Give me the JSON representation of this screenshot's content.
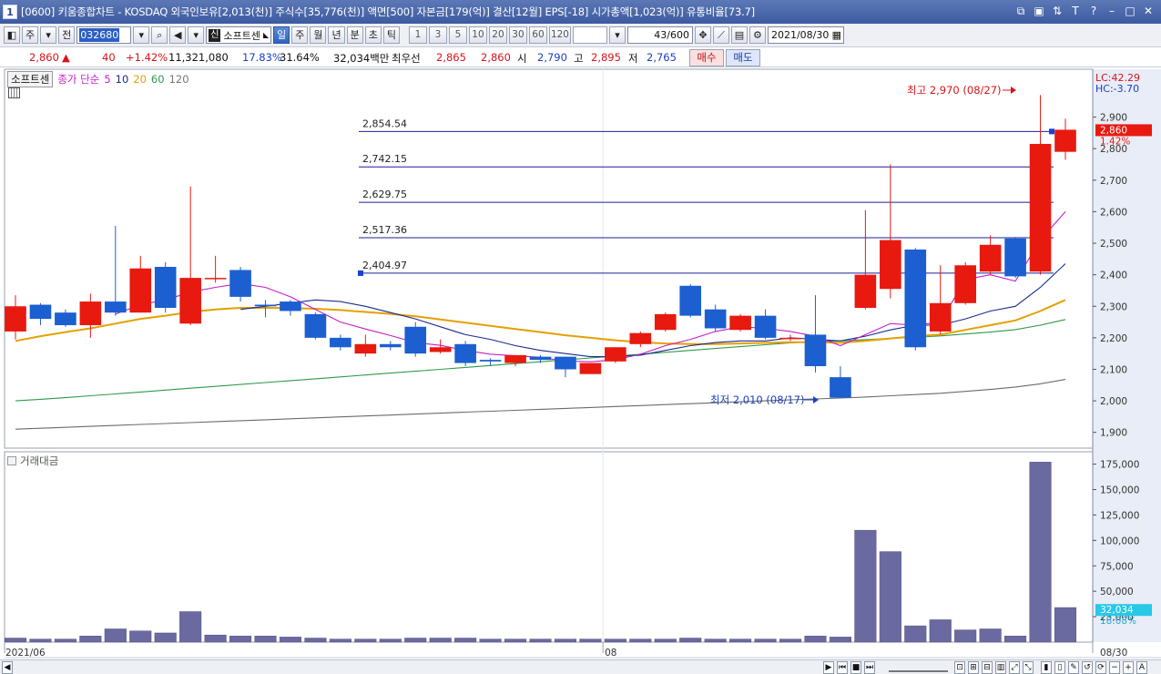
{
  "window": {
    "title": "[0600] 키움종합차트 - KOSDAQ 외국인보유[2,013(천)] 주식수[35,776(천)] 액면[500] 자본금[179(억)] 결산[12월] EPS[-18] 시가총액[1,023(억)] 유통비율[73.7]",
    "app_icon": "1"
  },
  "toolbar": {
    "type": "주",
    "prev": "전",
    "code": "032680",
    "stock_name": "소프트센",
    "shin": "신",
    "periods": [
      "일",
      "주",
      "월",
      "년",
      "분",
      "초",
      "틱"
    ],
    "active_period": "일",
    "intervals": [
      "1",
      "3",
      "5",
      "10",
      "20",
      "30",
      "60",
      "120"
    ],
    "count": "43/600",
    "date": "2021/08/30"
  },
  "quote": {
    "price": "2,860",
    "change": "40",
    "rate": "+1.42%",
    "volume": "11,321,080",
    "vol_rate": "17.83%",
    "turnover": "31.64%",
    "amount": "32,034백만",
    "best_label": "최우선",
    "ask": "2,865",
    "bid": "2,860",
    "open_label": "시",
    "open": "2,790",
    "high_label": "고",
    "high": "2,895",
    "low_label": "저",
    "low": "2,765",
    "buy": "매수",
    "sell": "매도"
  },
  "legend": {
    "stock": "소프트센",
    "ma_label": "종가 단순",
    "ma_periods": [
      "5",
      "10",
      "20",
      "60",
      "120"
    ],
    "ma_colors": [
      "#c21fc8",
      "#1a2b8f",
      "#e6a000",
      "#2e9a4a",
      "#555555"
    ],
    "volume_label": "거래대금"
  },
  "annotations": {
    "high_note": "최고 2,970 (08/27)",
    "low_note": "최저 2,010 (08/17)",
    "lc": "LC:42.29",
    "hc": "HC:-3.70",
    "price_tag": "2,860",
    "pct_tag": "1.42%",
    "vol_tag": "32,034",
    "vol_pct_tag": "18.08%"
  },
  "chart_data": {
    "type": "candlestick",
    "price_axis": {
      "min": 1850,
      "max": 3000,
      "ticks": [
        1900,
        2000,
        2100,
        2200,
        2300,
        2400,
        2500,
        2600,
        2700,
        2800,
        2900
      ],
      "tick_labels": [
        "1,900",
        "2,000",
        "2,100",
        "2,200",
        "2,300",
        "2,400",
        "2,500",
        "2,600",
        "2,700",
        "2,800",
        "2,900"
      ]
    },
    "volume_axis": {
      "min": 0,
      "max": 180000,
      "ticks": [
        25000,
        50000,
        75000,
        100000,
        125000,
        150000,
        175000
      ],
      "tick_labels": [
        "25,000",
        "50,000",
        "75,000",
        "100,000",
        "125,000",
        "150,000",
        "175,000"
      ]
    },
    "x_labels": [
      {
        "index": 0,
        "text": "2021/06"
      },
      {
        "index": 24,
        "text": "08"
      },
      {
        "index": 42,
        "text": "08/30"
      }
    ],
    "fib_levels": [
      {
        "value": 2854.54,
        "label": "2,854.54"
      },
      {
        "value": 2742.15,
        "label": "2,742.15"
      },
      {
        "value": 2629.75,
        "label": "2,629.75"
      },
      {
        "value": 2517.36,
        "label": "2,517.36"
      },
      {
        "value": 2404.97,
        "label": "2,404.97"
      }
    ],
    "candles": [
      {
        "o": 2220,
        "h": 2335,
        "l": 2195,
        "c": 2300
      },
      {
        "o": 2305,
        "h": 2310,
        "l": 2240,
        "c": 2260
      },
      {
        "o": 2280,
        "h": 2290,
        "l": 2235,
        "c": 2240
      },
      {
        "o": 2240,
        "h": 2340,
        "l": 2200,
        "c": 2315
      },
      {
        "o": 2315,
        "h": 2555,
        "l": 2270,
        "c": 2280
      },
      {
        "o": 2280,
        "h": 2460,
        "l": 2280,
        "c": 2420
      },
      {
        "o": 2425,
        "h": 2440,
        "l": 2280,
        "c": 2295
      },
      {
        "o": 2245,
        "h": 2680,
        "l": 2240,
        "c": 2390
      },
      {
        "o": 2390,
        "h": 2460,
        "l": 2375,
        "c": 2390
      },
      {
        "o": 2415,
        "h": 2425,
        "l": 2315,
        "c": 2330
      },
      {
        "o": 2305,
        "h": 2320,
        "l": 2265,
        "c": 2300
      },
      {
        "o": 2315,
        "h": 2320,
        "l": 2270,
        "c": 2285
      },
      {
        "o": 2275,
        "h": 2280,
        "l": 2195,
        "c": 2200
      },
      {
        "o": 2200,
        "h": 2210,
        "l": 2160,
        "c": 2170
      },
      {
        "o": 2150,
        "h": 2210,
        "l": 2140,
        "c": 2180
      },
      {
        "o": 2180,
        "h": 2190,
        "l": 2160,
        "c": 2170
      },
      {
        "o": 2235,
        "h": 2250,
        "l": 2140,
        "c": 2150
      },
      {
        "o": 2155,
        "h": 2195,
        "l": 2150,
        "c": 2170
      },
      {
        "o": 2180,
        "h": 2190,
        "l": 2110,
        "c": 2120
      },
      {
        "o": 2130,
        "h": 2135,
        "l": 2110,
        "c": 2125
      },
      {
        "o": 2120,
        "h": 2145,
        "l": 2110,
        "c": 2145
      },
      {
        "o": 2140,
        "h": 2145,
        "l": 2120,
        "c": 2130
      },
      {
        "o": 2140,
        "h": 2140,
        "l": 2075,
        "c": 2100
      },
      {
        "o": 2085,
        "h": 2120,
        "l": 2085,
        "c": 2120
      },
      {
        "o": 2125,
        "h": 2170,
        "l": 2120,
        "c": 2170
      },
      {
        "o": 2180,
        "h": 2220,
        "l": 2170,
        "c": 2215
      },
      {
        "o": 2225,
        "h": 2280,
        "l": 2220,
        "c": 2275
      },
      {
        "o": 2365,
        "h": 2370,
        "l": 2265,
        "c": 2270
      },
      {
        "o": 2290,
        "h": 2305,
        "l": 2220,
        "c": 2230
      },
      {
        "o": 2225,
        "h": 2275,
        "l": 2220,
        "c": 2270
      },
      {
        "o": 2270,
        "h": 2290,
        "l": 2195,
        "c": 2200
      },
      {
        "o": 2200,
        "h": 2210,
        "l": 2190,
        "c": 2200
      },
      {
        "o": 2210,
        "h": 2335,
        "l": 2090,
        "c": 2110
      },
      {
        "o": 2075,
        "h": 2110,
        "l": 2010,
        "c": 2010
      },
      {
        "o": 2295,
        "h": 2605,
        "l": 2290,
        "c": 2400
      },
      {
        "o": 2355,
        "h": 2750,
        "l": 2325,
        "c": 2510
      },
      {
        "o": 2480,
        "h": 2485,
        "l": 2160,
        "c": 2170
      },
      {
        "o": 2220,
        "h": 2430,
        "l": 2210,
        "c": 2310
      },
      {
        "o": 2310,
        "h": 2440,
        "l": 2305,
        "c": 2430
      },
      {
        "o": 2410,
        "h": 2525,
        "l": 2400,
        "c": 2495
      },
      {
        "o": 2515,
        "h": 2520,
        "l": 2390,
        "c": 2395
      },
      {
        "o": 2410,
        "h": 2970,
        "l": 2400,
        "c": 2815
      },
      {
        "o": 2790,
        "h": 2895,
        "l": 2765,
        "c": 2860
      }
    ],
    "volume": [
      4000,
      3000,
      3000,
      6000,
      13000,
      11000,
      9000,
      30000,
      7000,
      6000,
      6000,
      5000,
      4000,
      3000,
      3000,
      3000,
      4000,
      4000,
      4000,
      3000,
      3000,
      3000,
      3000,
      3000,
      3000,
      3000,
      3000,
      4000,
      3000,
      3000,
      3000,
      3000,
      6000,
      5000,
      110000,
      89000,
      16000,
      22000,
      12000,
      13000,
      6000,
      177000,
      34000
    ],
    "ma5": [
      null,
      null,
      null,
      null,
      2275,
      2305,
      2320,
      2345,
      2360,
      2372,
      2360,
      2330,
      2290,
      2250,
      2228,
      2207,
      2185,
      2176,
      2160,
      2148,
      2143,
      2138,
      2126,
      2124,
      2130,
      2148,
      2175,
      2195,
      2220,
      2235,
      2230,
      2220,
      2205,
      2175,
      2210,
      2245,
      2240,
      2250,
      2385,
      2400,
      2380,
      2510,
      2600
    ],
    "ma10": [
      null,
      null,
      null,
      null,
      null,
      null,
      null,
      null,
      null,
      2290,
      2300,
      2310,
      2320,
      2315,
      2300,
      2280,
      2260,
      2235,
      2210,
      2195,
      2175,
      2160,
      2150,
      2140,
      2140,
      2145,
      2160,
      2175,
      2185,
      2190,
      2190,
      2200,
      2195,
      2190,
      2205,
      2225,
      2240,
      2240,
      2260,
      2285,
      2300,
      2360,
      2435
    ],
    "ma20": [
      2190,
      2205,
      2218,
      2230,
      2245,
      2260,
      2270,
      2282,
      2290,
      2295,
      2295,
      2294,
      2292,
      2288,
      2282,
      2276,
      2268,
      2258,
      2248,
      2238,
      2228,
      2218,
      2208,
      2200,
      2192,
      2186,
      2182,
      2180,
      2180,
      2182,
      2184,
      2186,
      2186,
      2184,
      2190,
      2198,
      2205,
      2210,
      2225,
      2240,
      2255,
      2285,
      2320
    ],
    "ma60": [
      2000,
      2005,
      2010,
      2016,
      2022,
      2028,
      2034,
      2040,
      2046,
      2052,
      2058,
      2064,
      2070,
      2076,
      2082,
      2088,
      2094,
      2100,
      2106,
      2112,
      2118,
      2124,
      2130,
      2136,
      2142,
      2148,
      2154,
      2160,
      2166,
      2172,
      2178,
      2184,
      2188,
      2190,
      2194,
      2198,
      2202,
      2206,
      2212,
      2218,
      2226,
      2240,
      2258
    ],
    "ma120": [
      1910,
      1913,
      1916,
      1919,
      1922,
      1925,
      1928,
      1931,
      1934,
      1937,
      1940,
      1943,
      1946,
      1949,
      1952,
      1955,
      1958,
      1961,
      1964,
      1967,
      1970,
      1973,
      1976,
      1979,
      1982,
      1985,
      1988,
      1991,
      1994,
      1997,
      2000,
      2003,
      2006,
      2009,
      2012,
      2016,
      2020,
      2024,
      2030,
      2036,
      2044,
      2054,
      2068
    ]
  }
}
